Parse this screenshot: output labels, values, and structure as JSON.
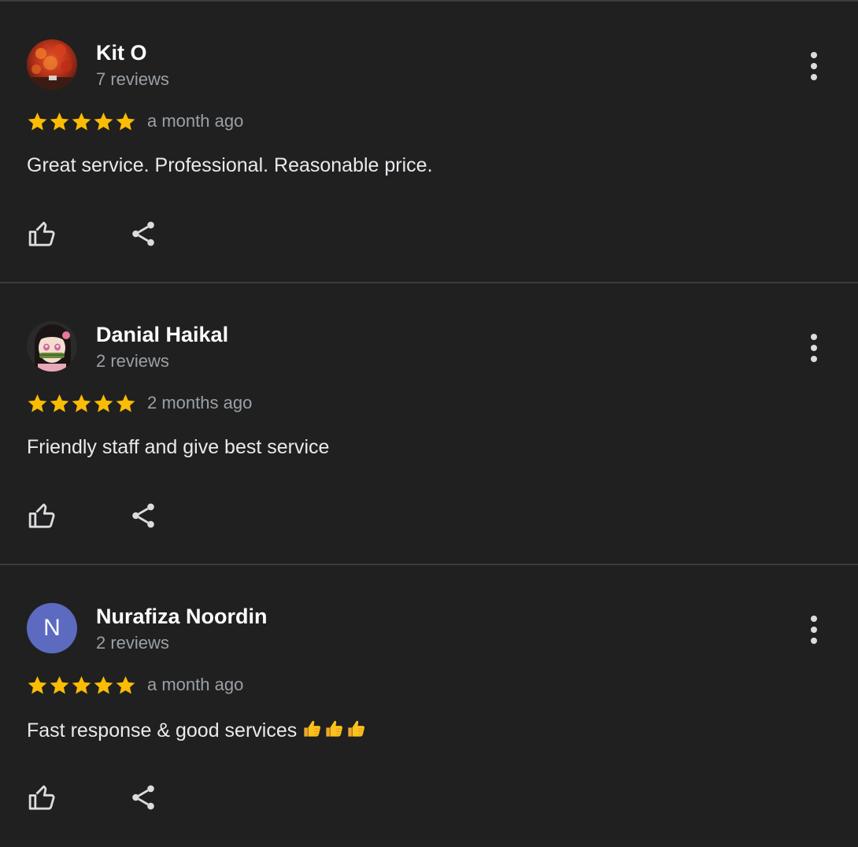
{
  "reviews": [
    {
      "reviewer_name": "Kit O",
      "review_count": "7 reviews",
      "rating": 5,
      "time_ago": "a month ago",
      "text": "Great service. Professional. Reasonable price.",
      "avatar_type": "photo-red-foliage"
    },
    {
      "reviewer_name": "Danial Haikal",
      "review_count": "2 reviews",
      "rating": 5,
      "time_ago": "2 months ago",
      "text": "Friendly staff and give best service",
      "avatar_type": "photo-anime-character"
    },
    {
      "reviewer_name": "Nurafiza Noordin",
      "review_count": "2 reviews",
      "rating": 5,
      "time_ago": "a month ago",
      "text": "Fast response & good services",
      "text_emoji": "👍👍👍",
      "avatar_type": "letter",
      "avatar_letter": "N",
      "avatar_color": "#5c6bc0"
    }
  ],
  "icons": {
    "star": "star-icon",
    "more": "more-vert-icon",
    "like": "thumbs-up-icon",
    "share": "share-icon"
  },
  "colors": {
    "background": "#202020",
    "divider": "#3c3c3c",
    "star": "#fbbc04",
    "name": "#ffffff",
    "secondary_text": "#9aa0a6",
    "body_text": "#e8eaed",
    "icon": "#dadce0"
  }
}
